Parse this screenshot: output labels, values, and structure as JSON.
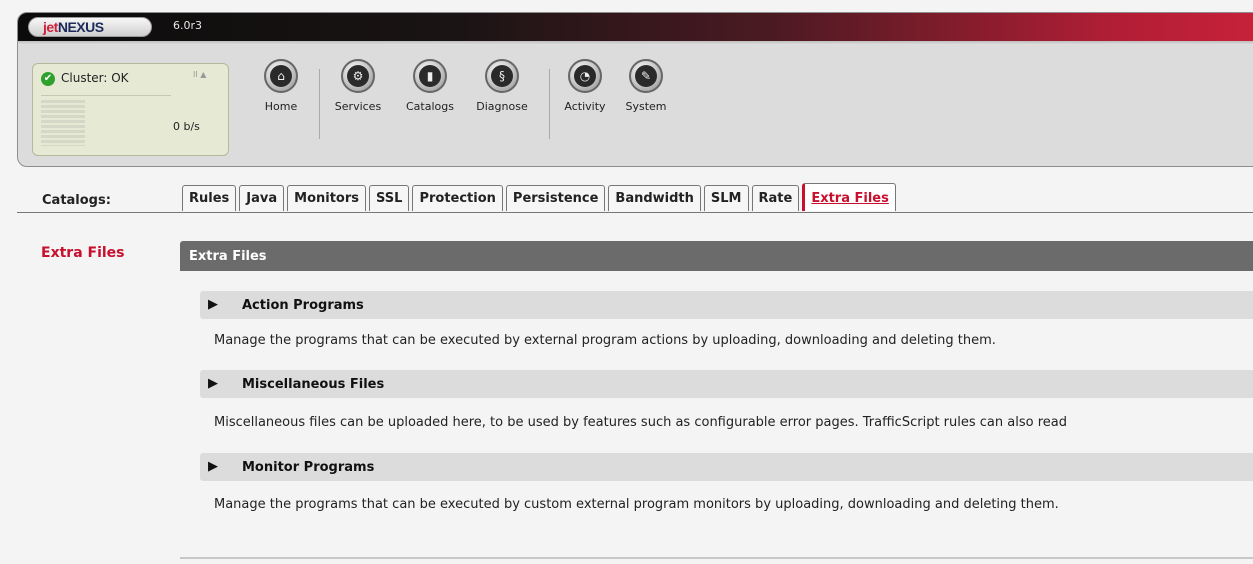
{
  "app": {
    "logo_prefix": "jet",
    "logo_suffix": "NEXUS",
    "version": "6.0r3"
  },
  "cluster": {
    "status": "Cluster: OK",
    "controls": "II ▲",
    "rate": "0 b/s"
  },
  "nav": [
    {
      "label": "Home",
      "icon": "home-icon"
    },
    {
      "label": "Services",
      "icon": "gear-icon"
    },
    {
      "label": "Catalogs",
      "icon": "book-icon"
    },
    {
      "label": "Diagnose",
      "icon": "stethoscope-icon"
    },
    {
      "label": "Activity",
      "icon": "gauge-icon"
    },
    {
      "label": "System",
      "icon": "wrench-icon"
    }
  ],
  "catalogs_label": "Catalogs:",
  "tabs": [
    "Rules",
    "Java",
    "Monitors",
    "SSL",
    "Protection",
    "Persistence",
    "Bandwidth",
    "SLM",
    "Rate",
    "Extra Files"
  ],
  "active_tab": "Extra Files",
  "side_nav": {
    "active": "Extra Files"
  },
  "panel": {
    "title": "Extra Files",
    "sections": [
      {
        "title": "Action Programs",
        "arrow": "▶",
        "description": "Manage the programs that can be executed by external program actions by uploading, downloading and deleting them."
      },
      {
        "title": "Miscellaneous Files",
        "arrow": "▶",
        "description": "Miscellaneous files can be uploaded here, to be used by features such as configurable error pages. TrafficScript rules can also read"
      },
      {
        "title": "Monitor Programs",
        "arrow": "▶",
        "description": "Manage the programs that can be executed by custom external program monitors by uploading, downloading and deleting them."
      }
    ]
  },
  "colors": {
    "accent": "#c8102e",
    "panel_header": "#6b6b6b",
    "section_bg": "#dcdcdc"
  }
}
